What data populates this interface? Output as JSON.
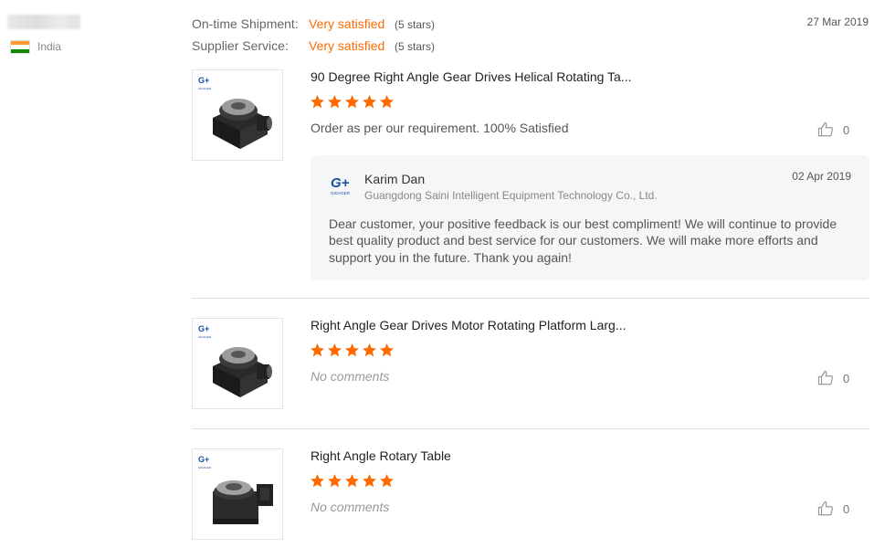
{
  "buyer": {
    "country": "India"
  },
  "flag_colors": [
    "#ff9933",
    "#ffffff",
    "#138808"
  ],
  "ratings": [
    {
      "label": "On-time Shipment:",
      "value": "Very satisfied",
      "stars": "(5 stars)"
    },
    {
      "label": "Supplier Service:",
      "value": "Very satisfied",
      "stars": "(5 stars)"
    }
  ],
  "review_date": "27 Mar 2019",
  "accent_color": "#ff6a00",
  "star_count": 5,
  "products": [
    {
      "title": "90 Degree Right Angle Gear Drives Helical Rotating Ta...",
      "comment": "Order as per our requirement. 100% Satisfied",
      "likes": "0"
    },
    {
      "title": "Right Angle Gear Drives Motor Rotating Platform Larg...",
      "comment": "No comments",
      "likes": "0"
    },
    {
      "title": "Right Angle Rotary Table",
      "comment": "No comments",
      "likes": "0"
    }
  ],
  "reply": {
    "name": "Karim Dan",
    "company": "Guangdong Saini Intelligent Equipment Technology Co., Ltd.",
    "date": "02 Apr 2019",
    "text": "Dear customer, your positive feedback is our best compliment! We will continue to provide best quality product and best service for our customers. We will make more efforts and support you in the future. Thank you again!",
    "logo_text": "G+"
  },
  "icons": {
    "like": "thumbs-up-icon",
    "star": "star-icon"
  }
}
